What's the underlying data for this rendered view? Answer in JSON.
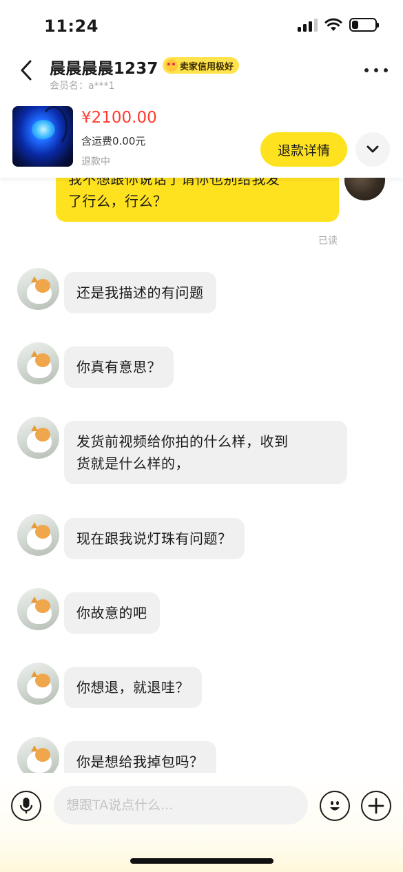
{
  "status_bar": {
    "time": "11:24"
  },
  "header": {
    "seller_name": "晨晨晨晨1237",
    "badge": "卖家信用极好",
    "member_id": "会员名：a***1"
  },
  "order": {
    "price": "¥2100.00",
    "shipping": "含运费0.00元",
    "status": "退款中",
    "refund_button": "退款详情"
  },
  "chat": {
    "outgoing": {
      "line1": "我不想跟你说话了请你也别给我发",
      "line2": "了行么，行么？",
      "read_status": "已读"
    },
    "incoming": [
      {
        "text": "还是我描述的有问题"
      },
      {
        "text": "你真有意思？"
      },
      {
        "line1": "发货前视频给你拍的什么样，收到",
        "line2": "货就是什么样的，"
      },
      {
        "text": "现在跟我说灯珠有问题？"
      },
      {
        "text": "你故意的吧"
      },
      {
        "text": "你想退，就退哇？"
      },
      {
        "text": "你是想给我掉包吗？"
      }
    ]
  },
  "input_bar": {
    "placeholder": "想跟TA说点什么..."
  },
  "icons": {
    "back": "chevron-left-icon",
    "more": "more-dots-icon",
    "expand": "chevron-down-icon",
    "mic": "microphone-icon",
    "emoji": "smiley-icon",
    "plus": "plus-icon"
  },
  "colors": {
    "accent_yellow": "#ffe21f",
    "price_red": "#ff3b30",
    "incoming_bubble": "#f0f0f0"
  }
}
